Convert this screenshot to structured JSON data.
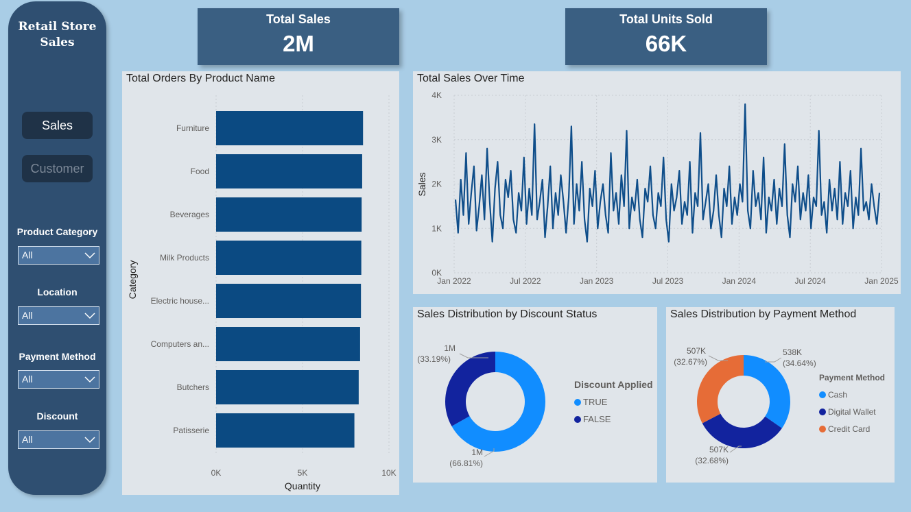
{
  "sidebar": {
    "title_line1": "Retail Store",
    "title_line2": "Sales",
    "nav": [
      {
        "label": "Sales"
      },
      {
        "label": "Customer"
      }
    ],
    "filters": [
      {
        "label": "Product Category",
        "value": "All"
      },
      {
        "label": "Location",
        "value": "All"
      },
      {
        "label": "Payment Method",
        "value": "All"
      },
      {
        "label": "Discount",
        "value": "All"
      }
    ]
  },
  "kpis": {
    "total_sales": {
      "title": "Total Sales",
      "value": "2M"
    },
    "total_units": {
      "title": "Total Units Sold",
      "value": "66K"
    }
  },
  "panels": {
    "bar": {
      "title": "Total Orders By Product Name"
    },
    "line": {
      "title": "Total Sales Over Time"
    },
    "donut_discount": {
      "title": "Sales Distribution by Discount Status"
    },
    "donut_payment": {
      "title": "Sales Distribution by Payment Method"
    }
  },
  "colors": {
    "bar": "#0b4a82",
    "line": "#0f4e8a",
    "true": "#118dff",
    "false": "#12239e",
    "cash": "#118dff",
    "digital_wallet": "#12239e",
    "credit_card": "#e66c37"
  },
  "chart_data": [
    {
      "type": "bar",
      "orientation": "horizontal",
      "title": "Total Orders By Product Name",
      "xlabel": "Quantity",
      "ylabel": "Category",
      "categories": [
        "Furniture",
        "Food",
        "Beverages",
        "Milk Products",
        "Electric house...",
        "Computers an...",
        "Butchers",
        "Patisserie"
      ],
      "values": [
        8500,
        8450,
        8420,
        8400,
        8380,
        8330,
        8250,
        8000
      ],
      "xlim": [
        0,
        10000
      ],
      "xticks": [
        "0K",
        "5K",
        "10K"
      ],
      "grid": true
    },
    {
      "type": "line",
      "title": "Total Sales Over Time",
      "ylabel": "Sales",
      "xlabel": "",
      "x_range": [
        "2022-01-01",
        "2024-12-31"
      ],
      "x_ticks": [
        "Jan 2022",
        "Jul 2022",
        "Jan 2023",
        "Jul 2023",
        "Jan 2024",
        "Jul 2024",
        "Jan 2025"
      ],
      "ylim": [
        0,
        4000
      ],
      "y_ticks": [
        "0K",
        "1K",
        "2K",
        "3K",
        "4K"
      ],
      "series": [
        {
          "values": [
            1650,
            900,
            2100,
            1300,
            2700,
            1100,
            1800,
            2400,
            950,
            1500,
            2200,
            1200,
            2800,
            1600,
            700,
            1900,
            2500,
            1300,
            1000,
            2100,
            1700,
            2300,
            1200,
            900,
            1800,
            1400,
            2600,
            1100,
            1900,
            1300,
            3350,
            1200,
            1600,
            2100,
            800,
            1500,
            2400,
            1000,
            1800,
            1300,
            2200,
            1600,
            900,
            1700,
            3300,
            1100,
            2000,
            1400,
            2500,
            1200,
            700,
            1900,
            1500,
            2300,
            1000,
            1600,
            2000,
            1300,
            900,
            2700,
            1400,
            1800,
            1100,
            2200,
            1500,
            3200,
            1000,
            1700,
            1400,
            2100,
            1200,
            800,
            1900,
            1600,
            2400,
            1300,
            1000,
            1800,
            1500,
            2600,
            1200,
            700,
            2000,
            1400,
            1700,
            2300,
            1100,
            1600,
            1300,
            2500,
            900,
            1800,
            1500,
            3150,
            1200,
            1600,
            2000,
            1000,
            1400,
            2200,
            1300,
            800,
            1900,
            1500,
            2400,
            1100,
            1700,
            1300,
            2000,
            1600,
            3800,
            1400,
            1000,
            2300,
            1500,
            1800,
            1200,
            2600,
            900,
            1700,
            1400,
            2100,
            1100,
            1900,
            1500,
            2900,
            1300,
            800,
            2000,
            1600,
            2400,
            1200,
            1800,
            1400,
            2200,
            1000,
            1700,
            1500,
            3200,
            1300,
            1600,
            900,
            2100,
            1400,
            1900,
            1200,
            2500,
            1100,
            1800,
            1500,
            2300,
            1000,
            1700,
            1300,
            2800,
            1400,
            1600,
            1200,
            2000,
            1500,
            1100,
            1800
          ]
        }
      ]
    },
    {
      "type": "pie",
      "title": "Sales Distribution by Discount Status",
      "legend_title": "Discount Applied",
      "slices": [
        {
          "label": "TRUE",
          "value": 66.81,
          "value_label": "1M",
          "pct_label": "(66.81%)"
        },
        {
          "label": "FALSE",
          "value": 33.19,
          "value_label": "1M",
          "pct_label": "(33.19%)"
        }
      ],
      "legend_position": "right"
    },
    {
      "type": "pie",
      "title": "Sales Distribution by Payment Method",
      "legend_title": "Payment Method",
      "slices": [
        {
          "label": "Cash",
          "value": 34.64,
          "value_label": "538K",
          "pct_label": "(34.64%)"
        },
        {
          "label": "Digital Wallet",
          "value": 32.68,
          "value_label": "507K",
          "pct_label": "(32.68%)"
        },
        {
          "label": "Credit Card",
          "value": 32.67,
          "value_label": "507K",
          "pct_label": "(32.67%)"
        }
      ],
      "legend_position": "right"
    }
  ]
}
